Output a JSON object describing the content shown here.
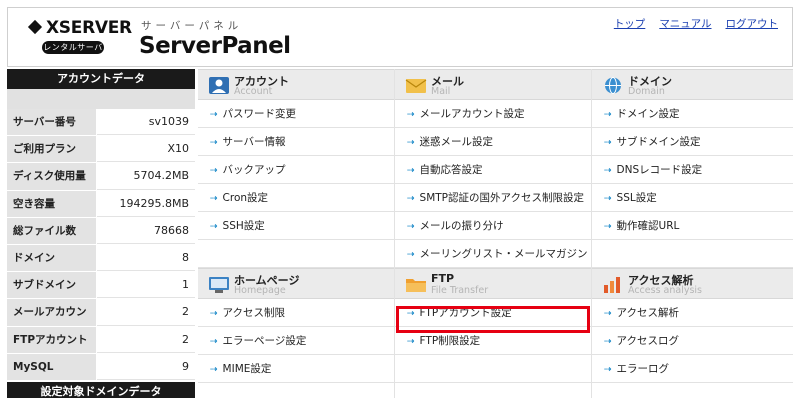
{
  "logo": {
    "brand": "XSERVER",
    "badge": "レンタルサーバー"
  },
  "panel": {
    "subtitle": "サーバーパネル",
    "title": "ServerPanel"
  },
  "topnav": [
    "トップ",
    "マニュアル",
    "ログアウト"
  ],
  "account": {
    "header": "アカウントデータ",
    "rows": [
      {
        "label": "サーバー番号",
        "value": "sv1039"
      },
      {
        "label": "ご利用プラン",
        "value": "X10"
      },
      {
        "label": "ディスク使用量",
        "value": "5704.2MB"
      },
      {
        "label": "空き容量",
        "value": "194295.8MB"
      },
      {
        "label": "総ファイル数",
        "value": "78668"
      },
      {
        "label": "ドメイン",
        "value": "8"
      },
      {
        "label": "サブドメイン",
        "value": "1"
      },
      {
        "label": "メールアカウント",
        "value": "2"
      },
      {
        "label": "FTPアカウント",
        "value": "2"
      },
      {
        "label": "MySQL",
        "value": "9"
      }
    ],
    "footer": "設定対象ドメインデータ"
  },
  "sections": {
    "account": {
      "title": "アカウント",
      "subtitle": "Account",
      "items": [
        "パスワード変更",
        "サーバー情報",
        "バックアップ",
        "Cron設定",
        "SSH設定"
      ]
    },
    "mail": {
      "title": "メール",
      "subtitle": "Mail",
      "items": [
        "メールアカウント設定",
        "迷惑メール設定",
        "自動応答設定",
        "SMTP認証の国外アクセス制限設定",
        "メールの振り分け",
        "メーリングリスト・メールマガジン"
      ]
    },
    "domain": {
      "title": "ドメイン",
      "subtitle": "Domain",
      "items": [
        "ドメイン設定",
        "サブドメイン設定",
        "DNSレコード設定",
        "SSL設定",
        "動作確認URL"
      ]
    },
    "homepage": {
      "title": "ホームページ",
      "subtitle": "Homepage",
      "items": [
        "アクセス制限",
        "エラーページ設定",
        "MIME設定"
      ]
    },
    "ftp": {
      "title": "FTP",
      "subtitle": "File Transfer",
      "items": [
        "FTPアカウント設定",
        "FTP制限設定"
      ]
    },
    "analytics": {
      "title": "アクセス解析",
      "subtitle": "Access analysis",
      "items": [
        "アクセス解析",
        "アクセスログ",
        "エラーログ"
      ]
    }
  },
  "colors": {
    "highlight": "#e60012",
    "arrow": "#1c8ac9",
    "link": "#1a3fb0"
  }
}
